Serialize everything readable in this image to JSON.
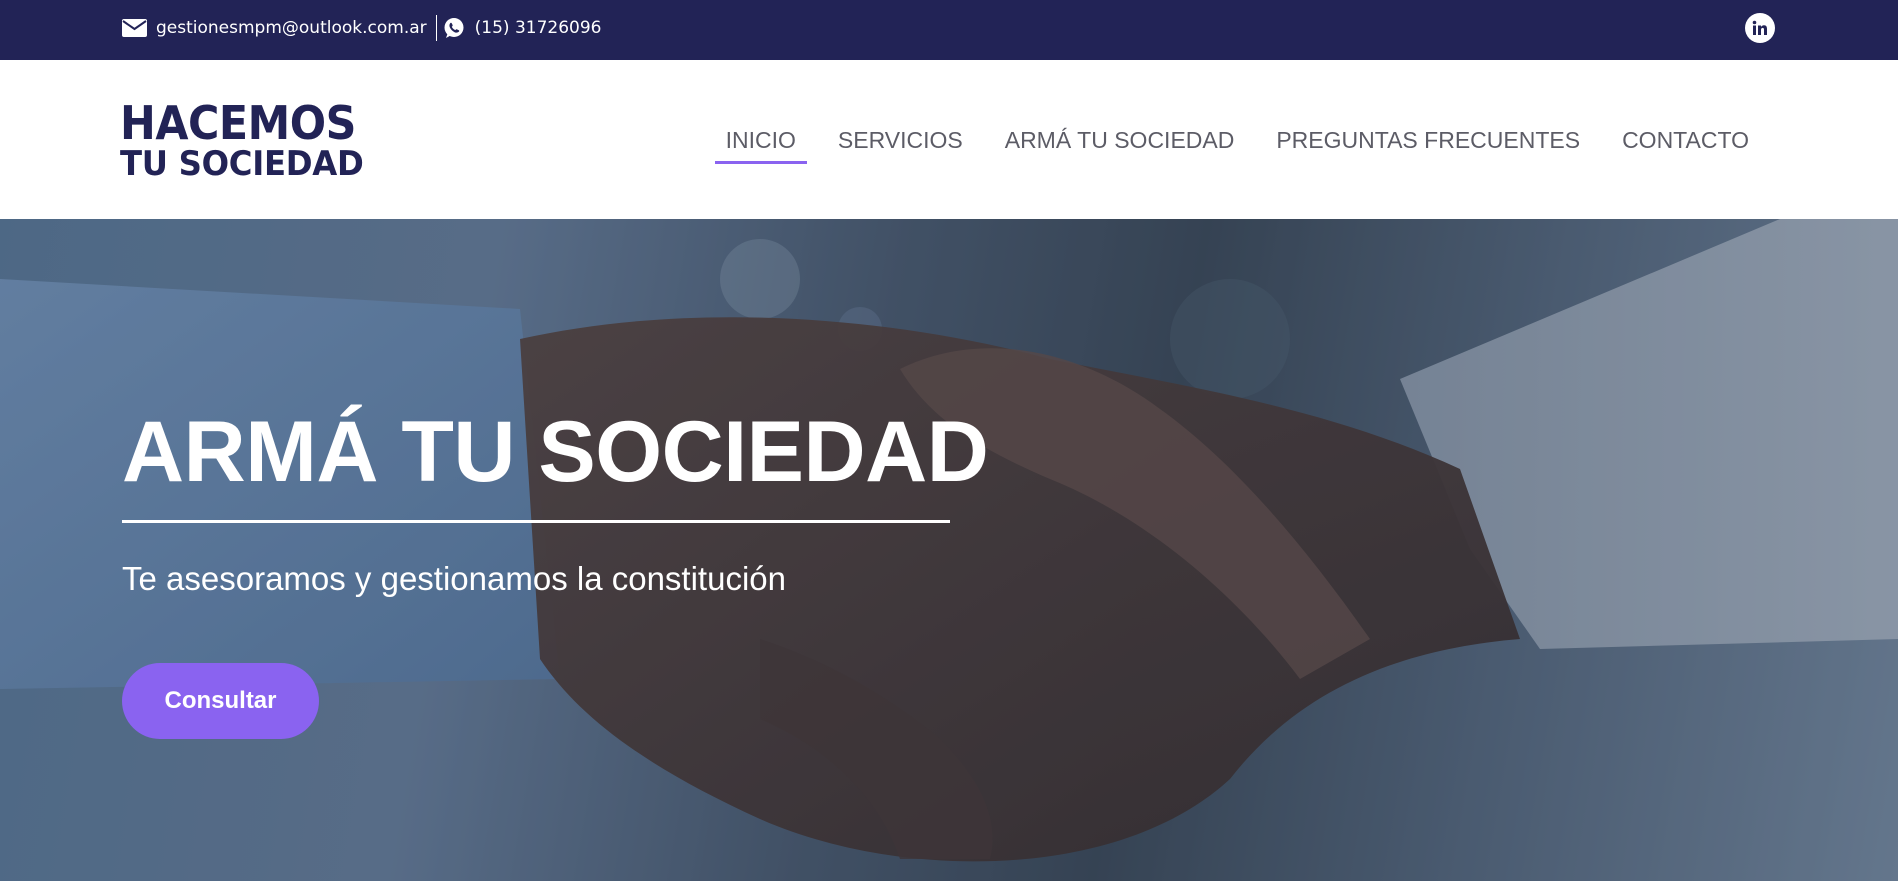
{
  "topbar": {
    "email": "gestionesmpm@outlook.com.ar",
    "phone": "(15) 31726096",
    "icons": {
      "email": "envelope-icon",
      "phone": "whatsapp-icon",
      "social": "linkedin-icon"
    }
  },
  "header": {
    "logo": {
      "line1": "HACEMOS",
      "line2": "TU SOCIEDAD"
    },
    "nav": [
      {
        "label": "INICIO",
        "active": true
      },
      {
        "label": "SERVICIOS",
        "active": false
      },
      {
        "label": "ARMÁ TU SOCIEDAD",
        "active": false
      },
      {
        "label": "PREGUNTAS FRECUENTES",
        "active": false
      },
      {
        "label": "CONTACTO",
        "active": false
      }
    ]
  },
  "hero": {
    "title": "ARMÁ TU SOCIEDAD",
    "subtitle": "Te asesoramos y gestionamos la constitución",
    "cta_label": "Consultar",
    "background": "handshake-photo"
  },
  "colors": {
    "topbar_bg": "#222356",
    "brand_navy": "#222356",
    "accent": "#8a63f0",
    "nav_text": "#5c5c66"
  }
}
